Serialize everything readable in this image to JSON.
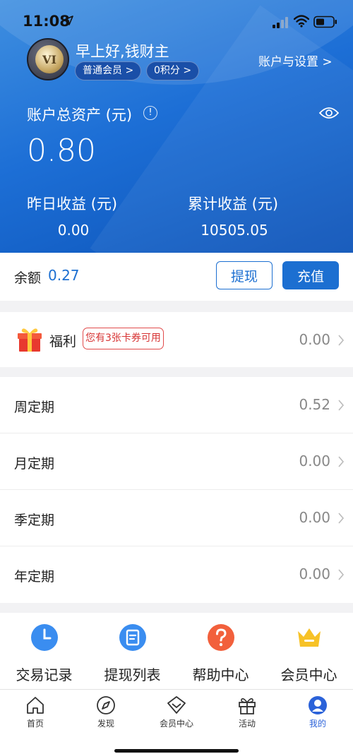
{
  "status_bar": {
    "time": "11:08"
  },
  "profile": {
    "avatar_text": "VI",
    "greeting": "早上好,钱财主",
    "member_pill": "普通会员 >",
    "points_pill": "0积分 >",
    "settings_link": "账户与设置  >"
  },
  "assets": {
    "label": "账户总资产 (元)",
    "value": "0.80",
    "yesterday_label": "昨日收益 (元)",
    "yesterday_value": "0.00",
    "cumulative_label": "累计收益 (元)",
    "cumulative_value": "10505.05"
  },
  "balance": {
    "label": "余额",
    "value": "0.27",
    "withdraw_label": "提现",
    "recharge_label": "充值"
  },
  "welfare": {
    "label": "福利",
    "coupon_tag": "您有3张卡券可用",
    "value": "0.00"
  },
  "terms": [
    {
      "label": "周定期",
      "value": "0.52"
    },
    {
      "label": "月定期",
      "value": "0.00"
    },
    {
      "label": "季定期",
      "value": "0.00"
    },
    {
      "label": "年定期",
      "value": "0.00"
    }
  ],
  "quick_links": [
    {
      "label": "交易记录",
      "icon": "clock-icon"
    },
    {
      "label": "提现列表",
      "icon": "document-icon"
    },
    {
      "label": "帮助中心",
      "icon": "help-icon"
    },
    {
      "label": "会员中心",
      "icon": "crown-icon"
    }
  ],
  "tabbar": {
    "items": [
      {
        "label": "首页",
        "icon": "home-icon"
      },
      {
        "label": "发现",
        "icon": "compass-icon"
      },
      {
        "label": "会员中心",
        "icon": "diamond-icon"
      },
      {
        "label": "活动",
        "icon": "gift-icon"
      },
      {
        "label": "我的",
        "icon": "user-icon"
      }
    ],
    "active": "我的"
  },
  "colors": {
    "brand_blue": "#1c6fd1",
    "coupon_red": "#e14b4b",
    "active_tab": "#2b62d9"
  }
}
